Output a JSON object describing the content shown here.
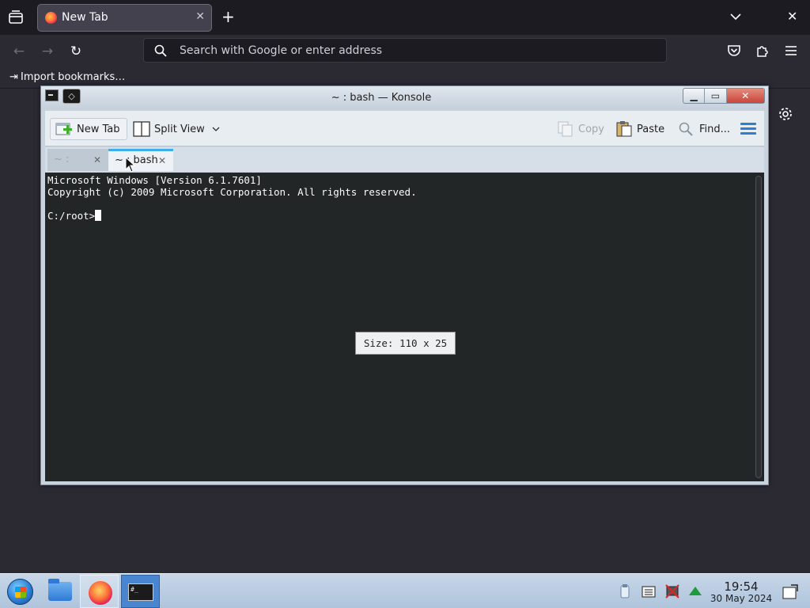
{
  "browser": {
    "tab": {
      "title": "New Tab"
    },
    "new_tab_symbol": "+",
    "close_symbol": "✕",
    "url_placeholder": "Search with Google or enter address",
    "bookmarks": {
      "import_label": "Import bookmarks…"
    },
    "nav": {
      "back": "←",
      "forward": "→",
      "reload": "↻"
    }
  },
  "konsole": {
    "title": "~ : bash — Konsole",
    "window_controls": {
      "minimize": "▁",
      "maximize": "▭",
      "close": "✕"
    },
    "toolbar": {
      "new_tab": "New Tab",
      "split_view": "Split View",
      "copy": "Copy",
      "paste": "Paste",
      "find": "Find..."
    },
    "tabs": [
      {
        "label": "~ : ",
        "active": false
      },
      {
        "label": "~ : bash",
        "active": true
      }
    ],
    "terminal": {
      "lines": [
        "Microsoft Windows [Version 6.1.7601]",
        "Copyright (c) 2009 Microsoft Corporation. All rights reserved.",
        "",
        "C:/root>"
      ],
      "size_tooltip": "Size: 110 x 25"
    }
  },
  "taskbar": {
    "time": "19:54",
    "date": "30 May 2024",
    "apps": [
      "file-manager",
      "firefox",
      "konsole"
    ],
    "terminal_task_label": "#_"
  },
  "colors": {
    "accent": "#3daee9",
    "terminal_bg": "#232627",
    "browser_bg": "#2b2a33"
  }
}
